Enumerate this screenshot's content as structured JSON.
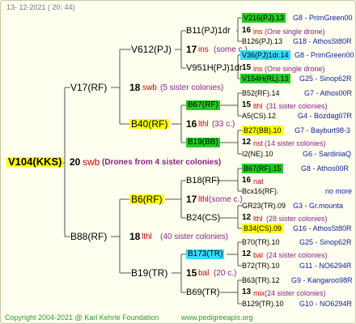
{
  "date": "13- 12-2021 ( 20: 44)",
  "root": {
    "id": "V104(KKS)",
    "num": "20",
    "code": "swb",
    "note": "(Drones from 4 sister colonies)"
  },
  "gen1": {
    "father": {
      "id": "V17(RF)",
      "num": "18",
      "code": "swb",
      "note": "(5 sister colonies)"
    },
    "mother": {
      "id": "B88(RF)",
      "num": "18",
      "code": "lthl",
      "note": "(40 sister colonies)"
    }
  },
  "gen2": {
    "ff": {
      "id": "V612(PJ)",
      "num": "17",
      "code": "ins",
      "note": "(some c.)"
    },
    "fm": {
      "id": "B40(RF)",
      "num": "16",
      "code": "lthl",
      "note": "(33 c.)"
    },
    "mf": {
      "id": "B6(RF)",
      "num": "17",
      "code": "lthl",
      "note": "(some c.)"
    },
    "mm": {
      "id": "B19(TR)",
      "num": "15",
      "code": "bal",
      "note": "(20 c.)"
    }
  },
  "gen3": {
    "a": {
      "id": "B11(PJ)1dr",
      "num": "16",
      "code": "ins",
      "note": "(One single drone)"
    },
    "b": {
      "id": "V951H(PJ)1dr",
      "num": "15",
      "code": "ins",
      "note": "(One single drone)"
    },
    "c": {
      "id": "B67(RF)",
      "num": "15",
      "code": "lthl",
      "note": "(31 sister colonies)"
    },
    "d": {
      "id": "B19(BB)",
      "num": "12",
      "code": "nst",
      "note": "(14 sister colonies)"
    },
    "e": {
      "id": "B18(RF)",
      "num": "16",
      "code": "nat",
      "note": ""
    },
    "f": {
      "id": "B24(CS)",
      "num": "12",
      "code": "lthl",
      "note": "(28 sister colonies)"
    },
    "g": {
      "id": "B173(TR)",
      "num": "12",
      "code": "bal",
      "note": "(24 sister colonies)"
    },
    "h": {
      "id": "B69(TR)",
      "num": "13",
      "code": "mix",
      "note": "(24 sister colonies)"
    }
  },
  "gen4": [
    {
      "id": "V216(PJ).13",
      "info": "G8 - PrimGreen00"
    },
    {
      "id": "B126(PJ).13",
      "info": "G18 - AthosSt80R"
    },
    {
      "id": "V36(PJ)1dr.14",
      "info": "G8 - PrimGreen00"
    },
    {
      "id": "V154H(RL).13",
      "info": "G25 - Sinop62R"
    },
    {
      "id": "B52(RF).14",
      "info": "G7 - Athos00R"
    },
    {
      "id": "A5(CS).12",
      "info": "G4 - Bozdag07R"
    },
    {
      "id": "B27(BB).10",
      "info": "G7 - Bayburt98-3"
    },
    {
      "id": "I2(NE).10",
      "info": "G6 - SardiniaQ"
    },
    {
      "id": "B67(RF).15",
      "info": "G8 - Athos00R"
    },
    {
      "id": "Bcx16(RF).",
      "info": "no more"
    },
    {
      "id": "GR23(TR).09",
      "info": "G3 - Gr.mounta"
    },
    {
      "id": "B34(CS).09",
      "info": "G16 - AthosSt80R"
    },
    {
      "id": "B70(TR).10",
      "info": "G25 - Sinop62R"
    },
    {
      "id": "B72(TR).10",
      "info": "G11 - NO6294R"
    },
    {
      "id": "B63(TR).12",
      "info": "G9 - Kangaroo98R"
    },
    {
      "id": "B129(TR).10",
      "info": "G10 - NO6294R"
    }
  ],
  "footer": {
    "copyright": "Copyright 2004-2021 @ Karl Kehrle Foundation",
    "url": "www.pedigreeapis.org"
  }
}
